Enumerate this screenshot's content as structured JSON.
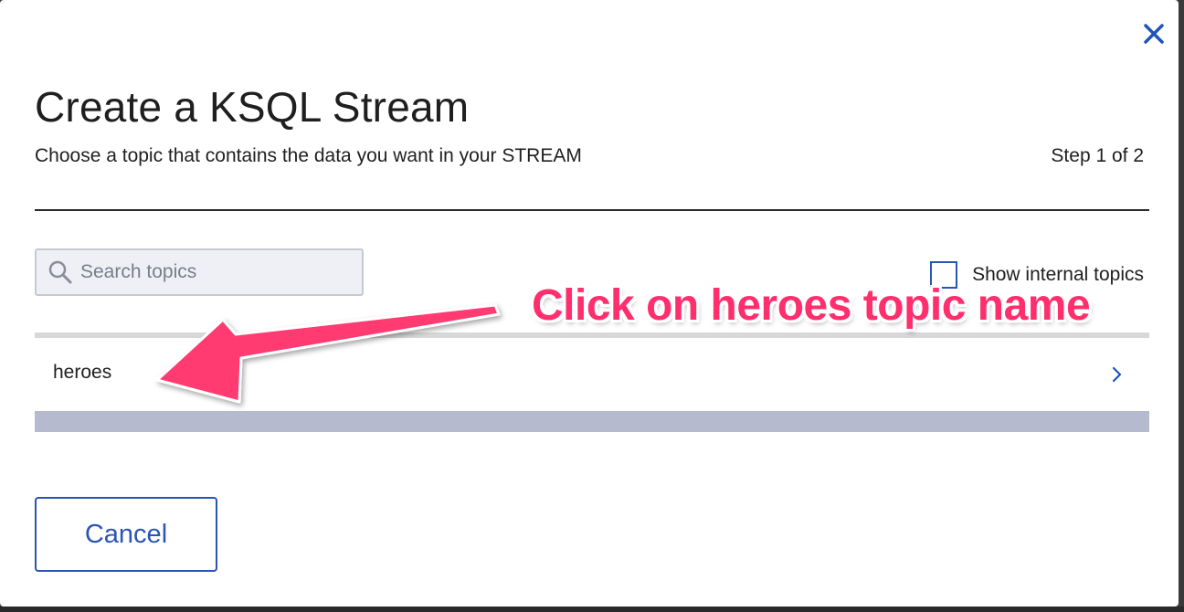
{
  "modal": {
    "title": "Create a KSQL Stream",
    "subtitle": "Choose a topic that contains the data you want in your STREAM",
    "step": "Step 1 of 2",
    "close_icon": "close-icon"
  },
  "search": {
    "placeholder": "Search topics",
    "value": "",
    "icon": "search-icon"
  },
  "internal_topics": {
    "label": "Show internal topics",
    "checked": false
  },
  "topics": [
    {
      "name": "heroes",
      "icon": "chevron-right-icon"
    }
  ],
  "footer": {
    "cancel_label": "Cancel"
  },
  "annotation": {
    "text": "Click on heroes topic name"
  },
  "colors": {
    "accent": "#2a55b3",
    "annotation": "#ff2f6e",
    "list_bar": "#b6bace"
  }
}
